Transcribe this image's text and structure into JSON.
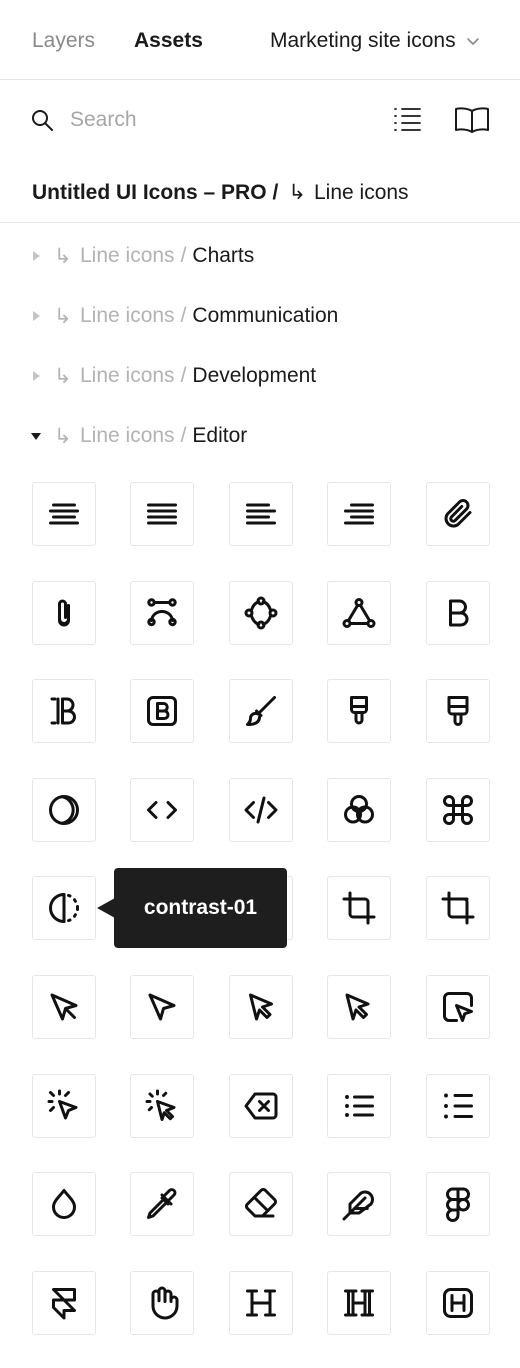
{
  "tabs": {
    "layers": "Layers",
    "assets": "Assets",
    "library": "Marketing site icons"
  },
  "search": {
    "placeholder": "Search"
  },
  "breadcrumb": {
    "root": "Untitled UI Icons – PRO",
    "separator": "/",
    "arrow": "↳",
    "current": "Line icons"
  },
  "groups": [
    {
      "arrow": "↳",
      "path": "Line icons",
      "slash": "/",
      "name": "Charts",
      "expanded": false
    },
    {
      "arrow": "↳",
      "path": "Line icons",
      "slash": "/",
      "name": "Communication",
      "expanded": false
    },
    {
      "arrow": "↳",
      "path": "Line icons",
      "slash": "/",
      "name": "Development",
      "expanded": false
    },
    {
      "arrow": "↳",
      "path": "Line icons",
      "slash": "/",
      "name": "Editor",
      "expanded": true
    }
  ],
  "icons": [
    "align-center-icon",
    "align-justify-icon",
    "align-left-icon",
    "align-right-icon",
    "attachment-01-icon",
    "attachment-02-icon",
    "bezier-curve-01-icon",
    "bezier-curve-02-icon",
    "bezier-curve-03-icon",
    "bold-01-icon",
    "bold-02-icon",
    "bold-square-icon",
    "brush-01-icon",
    "brush-02-icon",
    "brush-03-icon",
    "circle-cut-icon",
    "code-01-icon",
    "code-02-icon",
    "colors-icon",
    "command-icon",
    "contrast-01-icon",
    "contrast-02-icon",
    "contrast-03-icon",
    "crop-01-icon",
    "crop-02-icon",
    "cursor-01-icon",
    "cursor-02-icon",
    "cursor-03-icon",
    "cursor-04-icon",
    "cursor-box-icon",
    "cursor-click-01-icon",
    "cursor-click-02-icon",
    "delete-icon",
    "dotpoints-01-icon",
    "dotpoints-02-icon",
    "drop-icon",
    "dropper-icon",
    "eraser-icon",
    "feather-icon",
    "figma-icon",
    "framer-icon",
    "hand-icon",
    "heading-01-icon",
    "heading-02-icon",
    "heading-square-icon"
  ],
  "tooltip": {
    "text": "contrast-01"
  }
}
